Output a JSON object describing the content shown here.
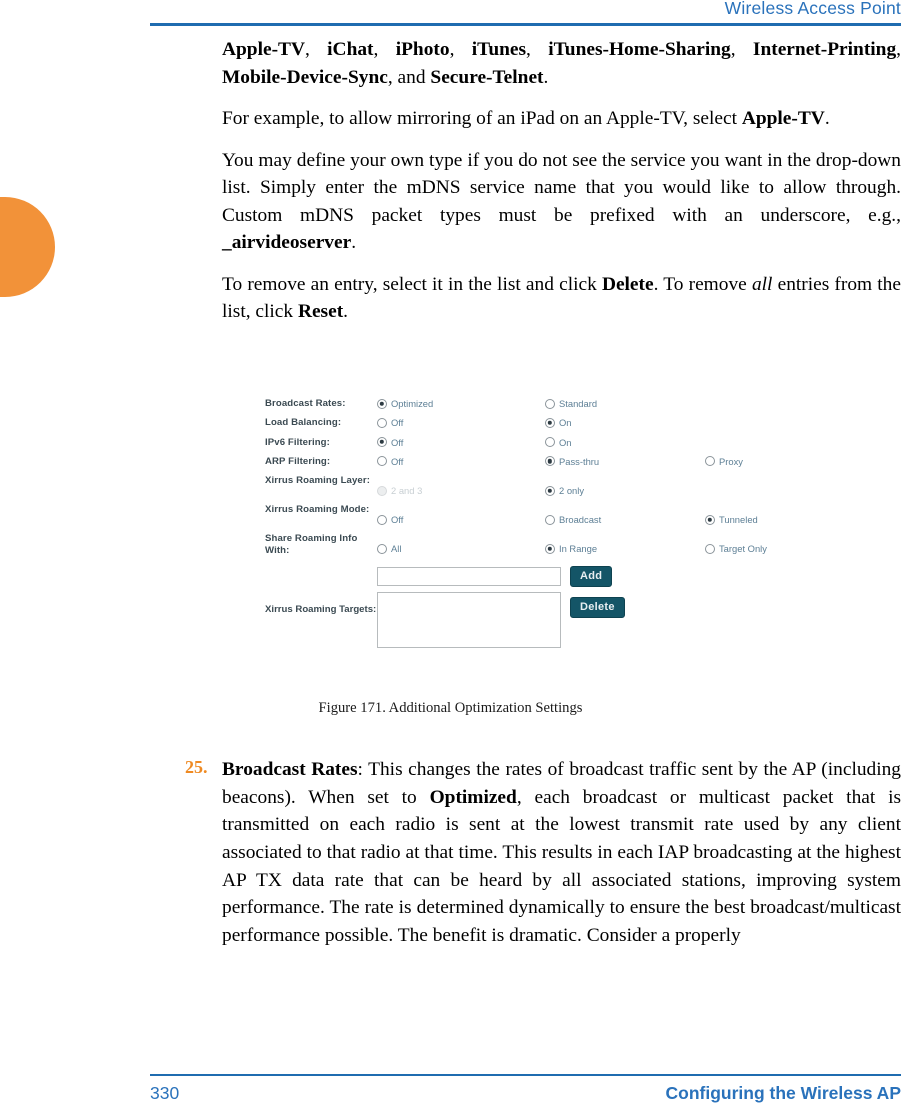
{
  "header": {
    "title": "Wireless Access Point"
  },
  "paragraphs": {
    "p1_pre": "",
    "p1_parts": [
      {
        "text": "Apple-TV",
        "bold": true
      },
      {
        "text": ", ",
        "bold": false
      },
      {
        "text": "iChat",
        "bold": true
      },
      {
        "text": ", ",
        "bold": false
      },
      {
        "text": "iPhoto",
        "bold": true
      },
      {
        "text": ", ",
        "bold": false
      },
      {
        "text": "iTunes",
        "bold": true
      },
      {
        "text": ", ",
        "bold": false
      },
      {
        "text": "iTunes-Home-Sharing",
        "bold": true
      },
      {
        "text": ", ",
        "bold": false
      },
      {
        "text": "Internet-Printing",
        "bold": true
      },
      {
        "text": ", ",
        "bold": false
      },
      {
        "text": "Mobile-Device-Sync",
        "bold": true
      },
      {
        "text": ", and ",
        "bold": false
      },
      {
        "text": "Secure-Telnet",
        "bold": true
      },
      {
        "text": ".",
        "bold": false
      }
    ],
    "p2_a": "For example, to allow mirroring of an iPad on an Apple-TV, select ",
    "p2_b": "Apple-TV",
    "p2_c": ".",
    "p3_a": "You may define your own type if you do not see the service you want in the drop-down list. Simply enter the mDNS service name that you would like to allow through. Custom mDNS packet types must be prefixed with an underscore, e.g., ",
    "p3_b": "_airvideoserver",
    "p3_c": ".",
    "p4_a": "To remove an entry, select it in the list and click ",
    "p4_b": "Delete",
    "p4_c": ". To remove ",
    "p4_d": "all",
    "p4_e": " entries from the list, click ",
    "p4_f": "Reset",
    "p4_g": "."
  },
  "figure": {
    "caption": "Figure 171. Additional Optimization Settings",
    "rows": [
      {
        "label": "Broadcast Rates:",
        "options": [
          {
            "label": "Optimized",
            "selected": true,
            "disabled": false
          },
          {
            "label": "Standard",
            "selected": false,
            "disabled": false
          }
        ]
      },
      {
        "label": "Load Balancing:",
        "options": [
          {
            "label": "Off",
            "selected": false,
            "disabled": false
          },
          {
            "label": "On",
            "selected": true,
            "disabled": false
          }
        ]
      },
      {
        "label": "IPv6 Filtering:",
        "options": [
          {
            "label": "Off",
            "selected": true,
            "disabled": false
          },
          {
            "label": "On",
            "selected": false,
            "disabled": false
          }
        ]
      },
      {
        "label": "ARP Filtering:",
        "options": [
          {
            "label": "Off",
            "selected": false,
            "disabled": false
          },
          {
            "label": "Pass-thru",
            "selected": true,
            "disabled": false
          },
          {
            "label": "Proxy",
            "selected": false,
            "disabled": false
          }
        ]
      },
      {
        "label": "Xirrus Roaming Layer:",
        "options": [
          {
            "label": "2 and 3",
            "selected": false,
            "disabled": true
          },
          {
            "label": "2 only",
            "selected": true,
            "disabled": false
          }
        ]
      },
      {
        "label": "Xirrus Roaming Mode:",
        "options": [
          {
            "label": "Off",
            "selected": false,
            "disabled": false
          },
          {
            "label": "Broadcast",
            "selected": false,
            "disabled": false
          },
          {
            "label": "Tunneled",
            "selected": true,
            "disabled": false
          }
        ]
      },
      {
        "label": "Share Roaming Info With:",
        "options": [
          {
            "label": "All",
            "selected": false,
            "disabled": false
          },
          {
            "label": "In Range",
            "selected": true,
            "disabled": false
          },
          {
            "label": "Target Only",
            "selected": false,
            "disabled": false
          }
        ]
      }
    ],
    "targets": {
      "label": "Xirrus Roaming Targets:",
      "input_value": "",
      "input_placeholder": "",
      "list_value": "",
      "add_label": "Add",
      "delete_label": "Delete"
    }
  },
  "numbered_item": {
    "number": "25.",
    "term": "Broadcast Rates",
    "text_a": ": This changes the rates of broadcast traffic sent by the AP (including beacons). When set to ",
    "term2": "Optimized",
    "text_b": ", each broadcast or multicast packet that is transmitted on each radio is sent at the lowest transmit rate used by any client associated to that radio at that time. This results in each IAP broadcasting at the highest AP TX data rate that can be heard by all associated stations, improving system performance. The rate is determined dynamically to ensure the best broadcast/multicast performance possible. The benefit is dramatic. Consider a properly"
  },
  "footer": {
    "page_number": "330",
    "section": "Configuring the Wireless AP"
  },
  "colors": {
    "header_blue": "#2a72bb",
    "rule_blue": "#1f6cb0",
    "tab_orange": "#f29239",
    "number_orange": "#ef8a22",
    "button_teal": "#145567",
    "form_label": "#3b4a52",
    "form_option": "#5d7f95"
  }
}
